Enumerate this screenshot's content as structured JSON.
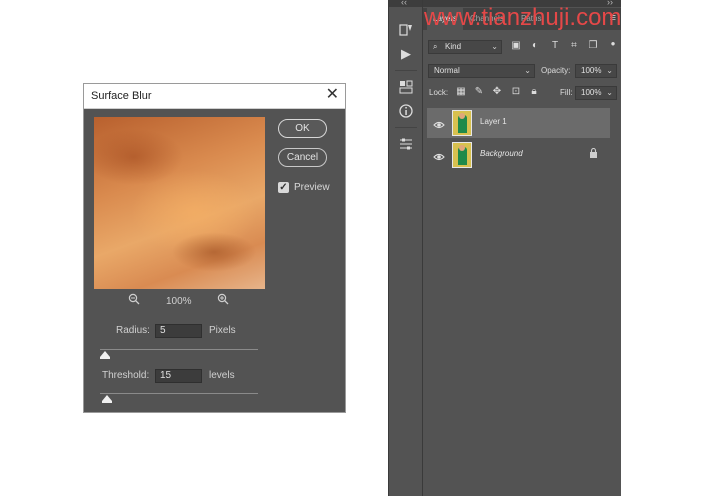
{
  "dialog": {
    "title": "Surface Blur",
    "ok_label": "OK",
    "cancel_label": "Cancel",
    "preview_label": "Preview",
    "preview_checked": true,
    "zoom_value": "100%",
    "radius_label": "Radius:",
    "radius_value": "5",
    "radius_unit": "Pixels",
    "threshold_label": "Threshold:",
    "threshold_value": "15",
    "threshold_unit": "levels"
  },
  "panel": {
    "tabs": [
      "Layers",
      "Channels",
      "Paths"
    ],
    "filter_kind": "Kind",
    "blend_mode": "Normal",
    "opacity_label": "Opacity:",
    "opacity_value": "100%",
    "lock_label": "Lock:",
    "fill_label": "Fill:",
    "fill_value": "100%",
    "layers": [
      {
        "name": "Layer 1",
        "selected": true,
        "locked": false
      },
      {
        "name": "Background",
        "selected": false,
        "locked": true
      }
    ]
  },
  "watermark": "www.tianzhuji.com",
  "colors": {
    "dialog_bg": "#535353",
    "panel_bg": "#535353",
    "accent_watermark": "#e54848"
  },
  "icons": {
    "tools": [
      "history-brush-icon",
      "play-icon",
      "properties-icon",
      "info-icon",
      "adjust-icon"
    ],
    "filters": [
      "image-filter-icon",
      "adjustment-filter-icon",
      "type-filter-icon",
      "shape-filter-icon",
      "smart-object-filter-icon"
    ],
    "locks": [
      "lock-transparent-icon",
      "lock-image-icon",
      "lock-position-icon",
      "lock-artboard-icon",
      "lock-all-icon"
    ]
  }
}
